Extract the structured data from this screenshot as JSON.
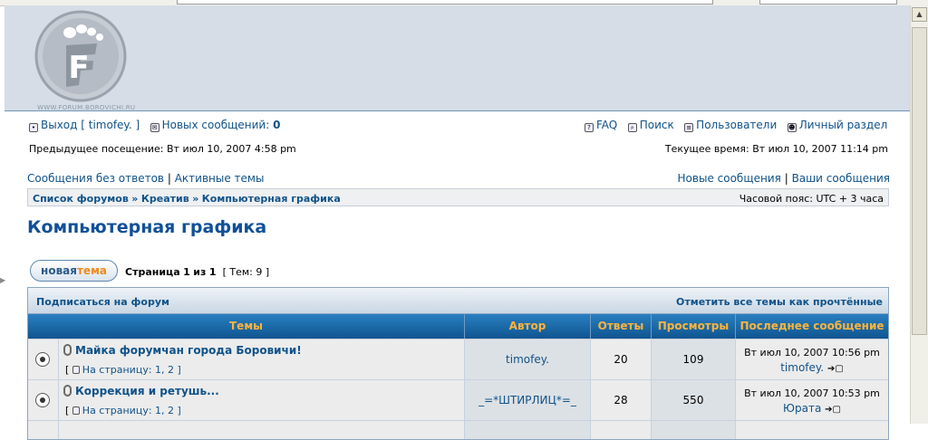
{
  "header": {
    "logo_letter": "F",
    "logo_caption": "WWW.FORUM.BOROVICHI.RU"
  },
  "userbar": {
    "logout_label": "Выход [ timofey. ]",
    "new_msgs_label": "Новых сообщений:",
    "new_msgs_count": "0",
    "faq": "FAQ",
    "search": "Поиск",
    "users": "Пользователи",
    "profile": "Личный раздел"
  },
  "visit": {
    "previous": "Предыдущее посещение: Вт июл 10, 2007 4:58 pm",
    "current": "Текущее время: Вт июл 10, 2007 11:14 pm"
  },
  "links": {
    "unanswered": "Сообщения без ответов",
    "active": "Активные темы",
    "sep": "|",
    "new_posts": "Новые сообщения",
    "your_posts": "Ваши сообщения"
  },
  "breadcrumb": {
    "items": [
      "Список форумов",
      "Креатив",
      "Компьютерная графика"
    ],
    "sep": "»",
    "timezone": "Часовой пояс: UTC + 3 часа"
  },
  "page_title": "Компьютерная графика",
  "new_topic": {
    "part1": "новая",
    "part2": "тема"
  },
  "pager": {
    "text": "Страница",
    "current": "1",
    "of": "из",
    "total": "1",
    "topics": "[ Тем: 9 ]"
  },
  "forum_actions": {
    "subscribe": "Подписаться на форум",
    "mark_read": "Отметить все темы как прочтённые"
  },
  "table": {
    "headers": [
      "Темы",
      "Автор",
      "Ответы",
      "Просмотры",
      "Последнее сообщение"
    ],
    "rows": [
      {
        "title": "Майка форумчан города Боровичи!",
        "pages_label": "[ ",
        "pages_text": "На страницу: 1, 2 ]",
        "author": "timofey.",
        "replies": "20",
        "views": "109",
        "last_date": "Вт июл 10, 2007 10:56 pm",
        "last_user": "timofey."
      },
      {
        "title": "Коррекция и ретушь...",
        "pages_label": "[ ",
        "pages_text": "На страницу: 1, 2 ]",
        "author": "_=*ШТИРЛИЦ*=_",
        "replies": "28",
        "views": "550",
        "last_date": "Вт июл 10, 2007 10:53 pm",
        "last_user": "Юрата"
      }
    ]
  }
}
